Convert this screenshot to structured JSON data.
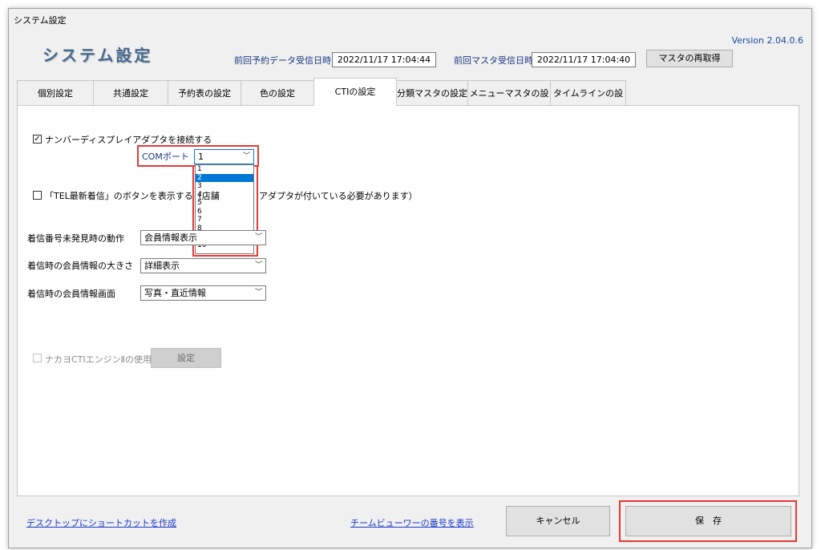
{
  "window": {
    "title": "システム設定"
  },
  "header": {
    "title": "システム設定",
    "version": "Version 2.04.0.6",
    "reservation_label": "前回予約データ受信日時",
    "reservation_value": "2022/11/17 17:04:44",
    "master_label": "前回マスタ受信日時",
    "master_value": "2022/11/17 17:04:40",
    "reacquire_button": "マスタの再取得"
  },
  "tabs": [
    {
      "label": "個別設定"
    },
    {
      "label": "共通設定"
    },
    {
      "label": "予約表の設定"
    },
    {
      "label": "色の設定"
    },
    {
      "label": "CTIの設定"
    },
    {
      "label": "分類マスタの設定"
    },
    {
      "label": "メニューマスタの設定"
    },
    {
      "label": "タイムラインの設定"
    }
  ],
  "cti": {
    "number_display_label": "ナンバーディスプレイアダプタを接続する",
    "number_display_checked": true,
    "com_port_label": "COMポート",
    "com_port_value": "1",
    "com_port_options": [
      "1",
      "2",
      "3",
      "4",
      "5",
      "6",
      "7",
      "8",
      "9",
      "10"
    ],
    "com_port_highlighted": "2",
    "tel_latest_label_a": "「TEL最新着信」のボタンを表示する（店舗",
    "tel_latest_label_b": "アダプタが付いている必要があります）",
    "tel_latest_checked": false,
    "unknown_number_label": "着信番号未発見時の動作",
    "unknown_number_value": "会員情報表示",
    "member_size_label": "着信時の会員情報の大きさ",
    "member_size_value": "詳細表示",
    "member_screen_label": "着信時の会員情報画面",
    "member_screen_value": "写真・直近情報",
    "nakayo_label": "ナカヨCTIエンジンⅡの使用",
    "nakayo_checked": false,
    "settings_button": "設定"
  },
  "footer": {
    "shortcut_link": "デスクトップにショートカットを作成",
    "teamviewer_link": "チームビューワーの番号を表示",
    "cancel_button": "キャンセル",
    "save_button": "保　存"
  },
  "colors": {
    "highlight_red": "#e53935",
    "link_blue": "#1a3ac8",
    "selection_blue": "#0078d7"
  },
  "icons": [
    "checkbox-checked",
    "checkbox-unchecked",
    "chevron-down-icon"
  ]
}
